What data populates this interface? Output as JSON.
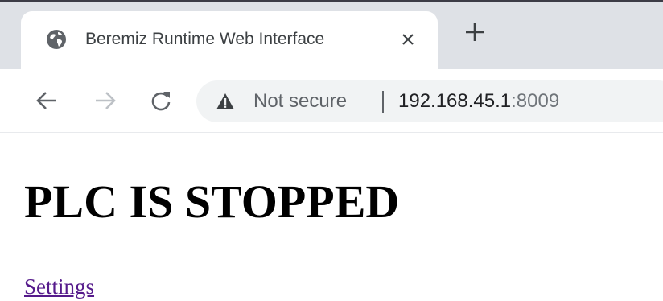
{
  "browser": {
    "tab": {
      "title": "Beremiz Runtime Web Interface",
      "favicon": "globe-icon",
      "close_icon": "close-icon"
    },
    "new_tab_icon": "plus-icon",
    "toolbar": {
      "back_icon": "arrow-left-icon",
      "forward_icon": "arrow-right-icon",
      "reload_icon": "reload-icon"
    },
    "address_bar": {
      "security_icon": "warning-icon",
      "security_label": "Not secure",
      "host": "192.168.45.1",
      "port": ":8009"
    }
  },
  "page": {
    "heading": "PLC IS STOPPED",
    "settings_link": "Settings"
  },
  "colors": {
    "tab_strip": "#dee1e6",
    "omnibox": "#f1f3f4",
    "link_visited": "#551a8b",
    "icon_gray": "#5f6368",
    "forward_disabled": "#bdc1c6"
  }
}
